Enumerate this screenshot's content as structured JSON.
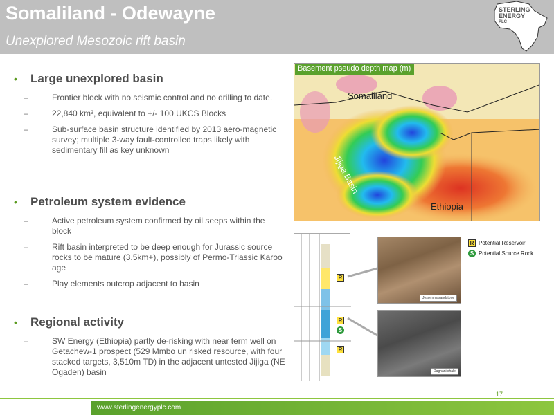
{
  "header": {
    "title": "Somaliland - Odewayne",
    "subtitle": "Unexplored Mesozoic rift basin",
    "logo": {
      "line1": "STERLING",
      "line2": "ENERGY",
      "line3": "PLC"
    }
  },
  "sections": [
    {
      "heading": "Large unexplored basin",
      "items": [
        "Frontier block with no seismic control and no drilling to date.",
        "22,840 km², equivalent to +/- 100 UKCS Blocks",
        "Sub-surface basin structure identified by 2013 aero-magnetic survey; multiple 3-way fault-controlled traps likely with sedimentary fill as key unknown"
      ]
    },
    {
      "heading": "Petroleum system evidence",
      "items": [
        "Active petroleum system confirmed by oil seeps within the block",
        "Rift basin interpreted to be deep enough for Jurassic source rocks to be mature (3.5km+), possibly of Permo-Triassic Karoo age",
        "Play elements outcrop adjacent to basin"
      ]
    },
    {
      "heading": "Regional activity",
      "items": [
        "SW Energy (Ethiopia) partly de-risking with near term well on Getachew-1 prospect (529 Mmbo un risked resource, with four stacked targets, 3,510m TD) in the adjacent untested Jijiga (NE Ogaden) basin"
      ]
    }
  ],
  "map": {
    "label": "Basement pseudo depth map (m)",
    "somaliland": "Somaliland",
    "ethiopia": "Ethiopia",
    "basin": "Jijiga Basin"
  },
  "legend": {
    "r_letter": "R",
    "s_letter": "S",
    "reservoir": "Potential Reservoir",
    "source": "Potential Source Rock"
  },
  "photos": {
    "top_caption": "Jesomma sandstone",
    "bottom_caption": "Daghani shale"
  },
  "footer": {
    "url": "www.sterlingenergyplc.com",
    "page": "17"
  },
  "colors": {
    "accent": "#8dc63f",
    "header": "#bfbfbf"
  }
}
